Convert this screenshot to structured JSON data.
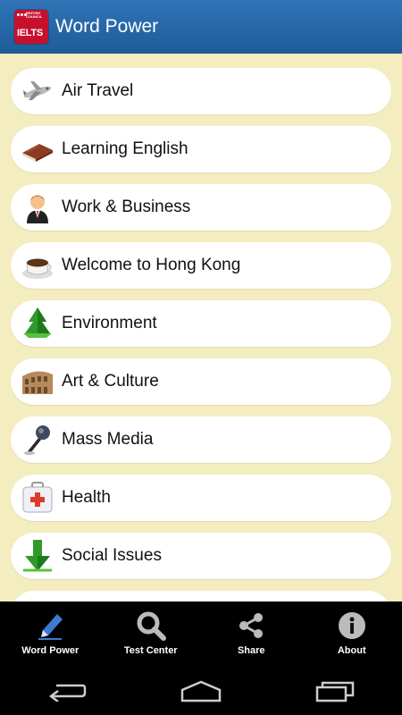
{
  "app": {
    "title": "Word Power",
    "logo_text": "IELTS",
    "logo_small_text": "BRITISH COUNCIL"
  },
  "topics": [
    {
      "label": "Air Travel",
      "icon": "airplane-icon"
    },
    {
      "label": "Learning English",
      "icon": "book-icon"
    },
    {
      "label": "Work & Business",
      "icon": "businessman-icon"
    },
    {
      "label": "Welcome to Hong Kong",
      "icon": "coffee-cup-icon"
    },
    {
      "label": "Environment",
      "icon": "tree-icon"
    },
    {
      "label": "Art & Culture",
      "icon": "colosseum-icon"
    },
    {
      "label": "Mass Media",
      "icon": "microphone-icon"
    },
    {
      "label": "Health",
      "icon": "first-aid-kit-icon"
    },
    {
      "label": "Social Issues",
      "icon": "down-arrow-icon"
    }
  ],
  "tabs": [
    {
      "label": "Word Power",
      "icon": "pencil-icon"
    },
    {
      "label": "Test Center",
      "icon": "search-icon"
    },
    {
      "label": "Share",
      "icon": "share-icon"
    },
    {
      "label": "About",
      "icon": "info-icon"
    }
  ],
  "colors": {
    "appbar": "#2a6cab",
    "background": "#f3edbf",
    "logo": "#c8102e"
  }
}
